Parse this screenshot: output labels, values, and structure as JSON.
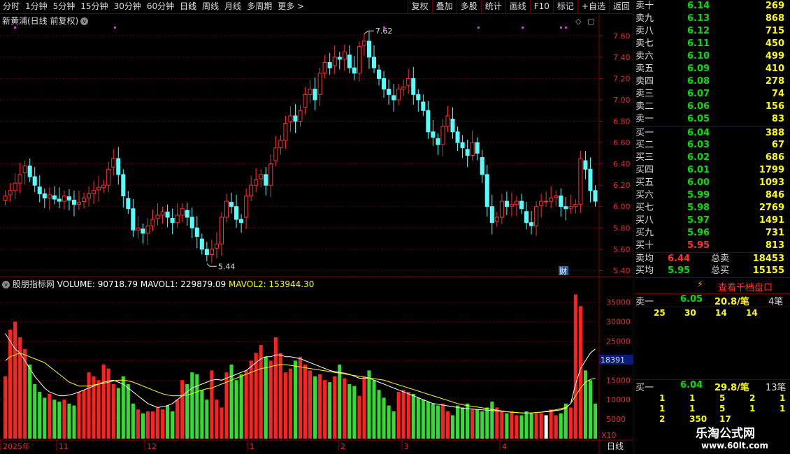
{
  "toolbar": {
    "periods": [
      "分时",
      "1分钟",
      "5分钟",
      "15分钟",
      "30分钟",
      "60分钟",
      "日线",
      "周线",
      "月线",
      "多周期",
      "更多 >"
    ],
    "active_period": "日线",
    "actions": [
      "复权",
      "叠加",
      "多股",
      "统计",
      "画线",
      "F10",
      "标记",
      "+自选",
      "返回"
    ]
  },
  "stock": {
    "title": "新黄浦(日线 前复权)",
    "high_label": "7.62",
    "low_label": "5.44",
    "cai_label": "财"
  },
  "indicator": {
    "title": "股朋指标网",
    "volume_text": "VOLUME: 90718.79",
    "mavol1_text": "MAVOL1: 229879.09",
    "mavol2_text": "MAVOL2: 153944.30",
    "current_marker": "18391",
    "x10": "X10",
    "colors": {
      "volume": "#ffffff",
      "mavol1": "#ffffff",
      "mavol2": "#ffff00"
    }
  },
  "price_axis": [
    "7.60",
    "7.40",
    "7.20",
    "7.00",
    "6.80",
    "6.60",
    "6.40",
    "6.20",
    "6.00",
    "5.80",
    "5.60",
    "5.40"
  ],
  "volume_axis": [
    "35000",
    "30000",
    "25000",
    "20000",
    "15000",
    "10000",
    "5000"
  ],
  "time_axis": [
    "2025年",
    "11",
    "12",
    "1",
    "2",
    "3",
    "4"
  ],
  "status_bar": {
    "period": "日线"
  },
  "order_book": {
    "asks": [
      {
        "label": "卖十",
        "price": "6.14",
        "vol": "269"
      },
      {
        "label": "卖九",
        "price": "6.13",
        "vol": "868"
      },
      {
        "label": "卖八",
        "price": "6.12",
        "vol": "715"
      },
      {
        "label": "卖七",
        "price": "6.11",
        "vol": "450"
      },
      {
        "label": "卖六",
        "price": "6.10",
        "vol": "499"
      },
      {
        "label": "卖五",
        "price": "6.09",
        "vol": "410"
      },
      {
        "label": "卖四",
        "price": "6.08",
        "vol": "278"
      },
      {
        "label": "卖三",
        "price": "6.07",
        "vol": "74"
      },
      {
        "label": "卖二",
        "price": "6.06",
        "vol": "156"
      },
      {
        "label": "卖一",
        "price": "6.05",
        "vol": "83"
      }
    ],
    "bids": [
      {
        "label": "买一",
        "price": "6.04",
        "vol": "388"
      },
      {
        "label": "买二",
        "price": "6.03",
        "vol": "67"
      },
      {
        "label": "买三",
        "price": "6.02",
        "vol": "686"
      },
      {
        "label": "买四",
        "price": "6.01",
        "vol": "1799"
      },
      {
        "label": "买五",
        "price": "6.00",
        "vol": "1093"
      },
      {
        "label": "买六",
        "price": "5.99",
        "vol": "846"
      },
      {
        "label": "买七",
        "price": "5.98",
        "vol": "2769"
      },
      {
        "label": "买八",
        "price": "5.97",
        "vol": "1491"
      },
      {
        "label": "买九",
        "price": "5.96",
        "vol": "731"
      },
      {
        "label": "买十",
        "price": "5.95",
        "vol": "813"
      }
    ],
    "ask_avg_label": "卖均",
    "ask_avg": "6.44",
    "total_sell_label": "总卖",
    "total_sell": "18453",
    "bid_avg_label": "买均",
    "bid_avg": "5.95",
    "total_buy_label": "总买",
    "total_buy": "15155"
  },
  "queue": {
    "button": "查看千档盘口",
    "sell_label": "卖一",
    "sell_price": "6.05",
    "sell_per": "20.8/笔",
    "sell_count": "4笔",
    "sell_orders": [
      "25",
      "30",
      "14",
      "14"
    ],
    "buy_label": "买一",
    "buy_price": "6.04",
    "buy_per": "29.8/笔",
    "buy_count": "13笔",
    "buy_orders_row1": [
      "1",
      "1",
      "5",
      "2",
      "1"
    ],
    "buy_orders_row2": [
      "1",
      "1",
      "5",
      "1",
      "1"
    ],
    "buy_orders_row3": [
      "2",
      "350",
      "17"
    ]
  },
  "watermark": {
    "name": "乐淘公式网",
    "url": "www.60lt.com"
  },
  "chart_data": {
    "type": "candlestick",
    "price_ylim": [
      5.37,
      7.7
    ],
    "volume_ylim": [
      0,
      38000
    ],
    "high": 7.62,
    "low": 5.44,
    "close": [
      6.1,
      6.15,
      6.22,
      6.3,
      6.38,
      6.28,
      6.2,
      6.12,
      6.08,
      6.11,
      6.07,
      6.05,
      6.1,
      6.06,
      6.02,
      6.04,
      6.08,
      6.12,
      6.15,
      6.18,
      6.2,
      6.35,
      6.45,
      6.3,
      6.1,
      5.98,
      5.78,
      5.8,
      5.75,
      5.82,
      5.88,
      5.92,
      5.95,
      5.9,
      5.85,
      5.92,
      5.98,
      5.9,
      5.8,
      5.72,
      5.6,
      5.55,
      5.6,
      5.65,
      5.9,
      6.05,
      6.0,
      5.88,
      5.85,
      6.1,
      6.2,
      6.25,
      6.3,
      6.2,
      6.4,
      6.55,
      6.62,
      6.78,
      6.85,
      6.8,
      6.9,
      7.05,
      7.1,
      7.0,
      7.25,
      7.35,
      7.3,
      7.4,
      7.38,
      7.45,
      7.3,
      7.25,
      7.5,
      7.55,
      7.4,
      7.3,
      7.2,
      7.1,
      7.05,
      7.0,
      7.1,
      7.12,
      7.2,
      7.05,
      7.0,
      6.9,
      6.7,
      6.65,
      6.58,
      6.75,
      6.85,
      6.7,
      6.6,
      6.55,
      6.48,
      6.6,
      6.5,
      6.3,
      6.0,
      5.85,
      5.9,
      6.05,
      6.0,
      6.02,
      6.05,
      5.98,
      5.85,
      5.82,
      6.0,
      6.05,
      6.05,
      6.08,
      6.1,
      6.0,
      5.98,
      6.0,
      6.02,
      6.45,
      6.35,
      6.15,
      6.05
    ],
    "volume": [
      16000,
      28000,
      30000,
      26000,
      23000,
      19000,
      14000,
      12000,
      10500,
      11500,
      10000,
      9500,
      10000,
      9000,
      8500,
      12000,
      12500,
      17000,
      16000,
      15000,
      19000,
      18000,
      14000,
      13000,
      16000,
      14000,
      9000,
      7500,
      6500,
      7000,
      7000,
      8000,
      7500,
      8500,
      7000,
      10000,
      15000,
      14000,
      17000,
      16500,
      12500,
      10000,
      17500,
      10000,
      8000,
      17000,
      19000,
      15000,
      16500,
      17500,
      20000,
      22000,
      24000,
      21000,
      20000,
      26000,
      22000,
      17000,
      18000,
      20000,
      21000,
      19000,
      17500,
      16000,
      16500,
      15000,
      14500,
      16000,
      19000,
      15500,
      14000,
      13500,
      11000,
      16000,
      17500,
      15000,
      12500,
      10500,
      8500,
      7000,
      12000,
      12500,
      12000,
      11500,
      10500,
      10000,
      9500,
      9000,
      8500,
      9000,
      7000,
      6000,
      8500,
      8000,
      9000,
      7500,
      7500,
      7000,
      8000,
      9500,
      8000,
      7000,
      6500,
      7000,
      6000,
      6000,
      7000,
      6500,
      6500,
      6500,
      6000,
      7500,
      6000,
      6500,
      9000,
      8000,
      37000,
      34000,
      17500,
      15000,
      9000
    ],
    "mavol1": [
      27000,
      25000,
      23000,
      22000,
      20000,
      18000,
      16000,
      14500,
      13000,
      12000,
      11500,
      11000,
      11000,
      11200,
      11500,
      12000,
      12500,
      13000,
      13500,
      14000,
      14500,
      14800,
      15000,
      14500,
      14000,
      13000,
      12000,
      11000,
      10000,
      9000,
      8500,
      8000,
      8200,
      8500,
      9000,
      10000,
      11000,
      12000,
      13000,
      13500,
      14000,
      14500,
      15000,
      15200,
      15000,
      15500,
      16000,
      16500,
      17000,
      17500,
      18500,
      19500,
      20500,
      21000,
      21000,
      21500,
      21500,
      21000,
      21000,
      20800,
      20500,
      20000,
      19500,
      19000,
      18500,
      18000,
      17500,
      17200,
      17000,
      16800,
      16500,
      16000,
      15500,
      15500,
      15500,
      15000,
      14500,
      14000,
      13500,
      13000,
      12500,
      12000,
      11500,
      11000,
      10500,
      10000,
      9500,
      9000,
      8800,
      8600,
      8400,
      8200,
      8000,
      7800,
      7700,
      7600,
      7500,
      7400,
      7300,
      7200,
      7100,
      7000,
      6900,
      6800,
      6700,
      6600,
      6600,
      6600,
      6700,
      6800,
      6900,
      7000,
      7200,
      7400,
      7800,
      9000,
      14000,
      18000,
      20000,
      22000,
      23000
    ],
    "mavol2": [
      20000,
      21000,
      21500,
      22000,
      21500,
      21000,
      20500,
      20000,
      19500,
      18500,
      17500,
      16500,
      15500,
      14500,
      14000,
      13500,
      13500,
      13500,
      13800,
      14000,
      14200,
      14500,
      14800,
      15000,
      15000,
      14800,
      14500,
      14000,
      13500,
      13000,
      12500,
      12000,
      11500,
      11200,
      11000,
      11000,
      11000,
      11200,
      11500,
      12000,
      12500,
      12800,
      13000,
      13500,
      14000,
      14500,
      15000,
      15500,
      16000,
      16500,
      17000,
      17500,
      18000,
      18200,
      18500,
      18800,
      19000,
      19000,
      18800,
      18600,
      18400,
      18200,
      18000,
      17800,
      17600,
      17400,
      17200,
      17000,
      16800,
      16600,
      16400,
      16200,
      16000,
      15800,
      15600,
      15400,
      15200,
      15000,
      14600,
      14200,
      13800,
      13400,
      13000,
      12600,
      12200,
      11800,
      11400,
      11000,
      10600,
      10200,
      9800,
      9400,
      9000,
      8700,
      8500,
      8300,
      8100,
      7900,
      7700,
      7500,
      7300,
      7100,
      6900,
      6800,
      6700,
      6600,
      6600,
      6600,
      6700,
      6800,
      7000,
      7200,
      7400,
      7700,
      8000,
      9000,
      11000,
      13000,
      14500,
      15200,
      15500
    ]
  }
}
